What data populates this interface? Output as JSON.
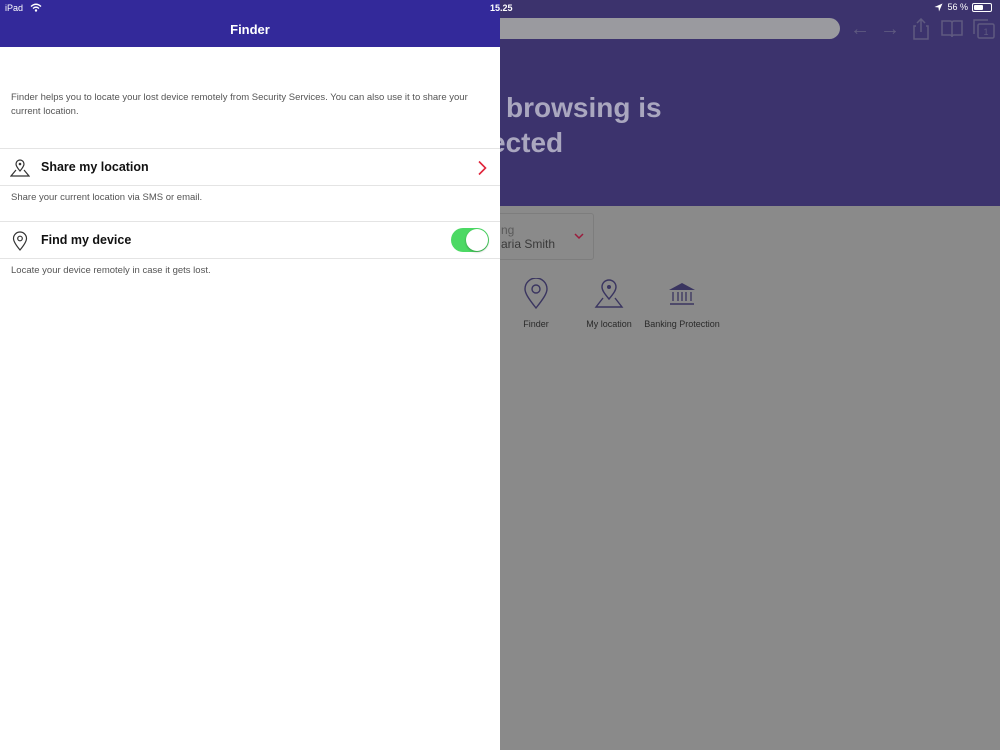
{
  "status_bar": {
    "device": "iPad",
    "time": "15.25",
    "battery_text": "56 %",
    "battery_level": 0.56
  },
  "panel": {
    "title": "Finder",
    "intro": "Finder helps you to locate your lost device remotely from Security Services. You can also use it to share your current location.",
    "share": {
      "label": "Share my location",
      "description": "Share your current location via SMS or email."
    },
    "find": {
      "label": "Find my device",
      "description": "Locate your device remotely in case it gets lost.",
      "enabled": true
    }
  },
  "background": {
    "headline_line1": "browsing is",
    "headline_line2": "ected",
    "card_line1": "ng",
    "card_line2": "aria Smith",
    "tab_count": "1",
    "features": [
      {
        "label": "Finder",
        "icon": "location-pin-icon"
      },
      {
        "label": "My location",
        "icon": "map-pin-icon"
      },
      {
        "label": "Banking Protection",
        "icon": "bank-icon"
      }
    ]
  },
  "colors": {
    "header": "#33299a",
    "hero": "#3c336d",
    "toggle_on": "#4cd964",
    "chevron": "#e0243a"
  }
}
